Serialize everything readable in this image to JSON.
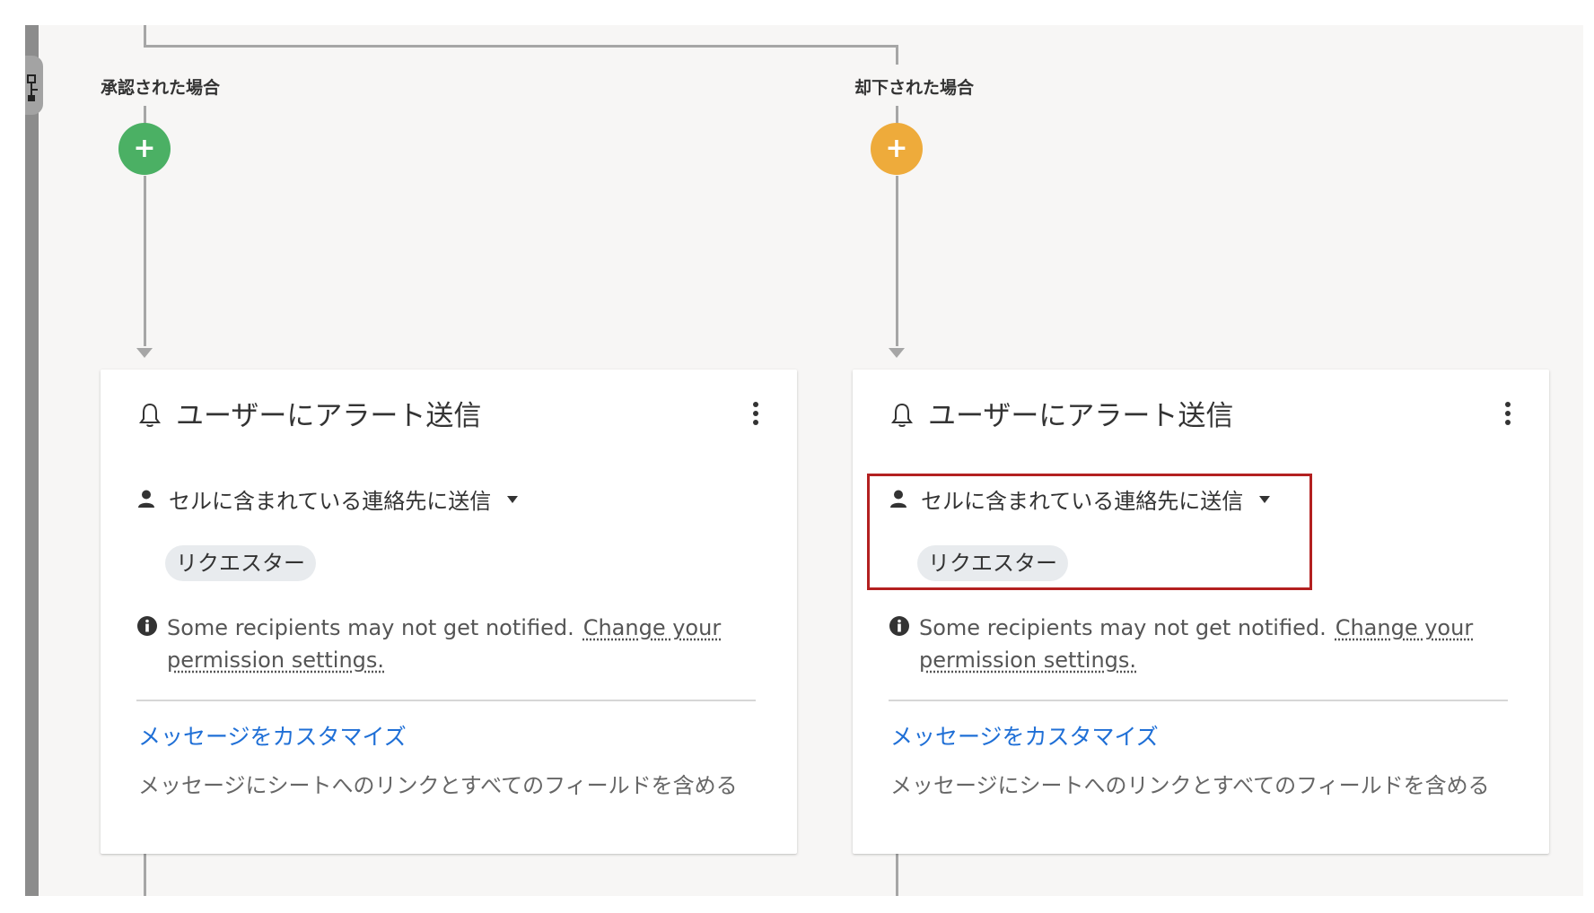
{
  "branches": [
    {
      "label": "承認された場合",
      "add_button": "+",
      "color": "#4bb064",
      "card": {
        "title": "ユーザーにアラート送信",
        "recipient_mode": "セルに含まれている連絡先に送信",
        "recipient_chip": "リクエスター",
        "notice_text": "Some recipients may not get notified.",
        "notice_link": "Change your permission settings.",
        "customize_link": "メッセージをカスタマイズ",
        "description": "メッセージにシートへのリンクとすべてのフィールドを含める"
      }
    },
    {
      "label": "却下された場合",
      "add_button": "+",
      "color": "#eeab3b",
      "card": {
        "title": "ユーザーにアラート送信",
        "recipient_mode": "セルに含まれている連絡先に送信",
        "recipient_chip": "リクエスター",
        "notice_text": "Some recipients may not get notified.",
        "notice_link": "Change your permission settings.",
        "customize_link": "メッセージをカスタマイズ",
        "description": "メッセージにシートへのリンクとすべてのフィールドを含める"
      }
    }
  ],
  "highlight_color": "#b32020",
  "link_color": "#1f6fd6"
}
